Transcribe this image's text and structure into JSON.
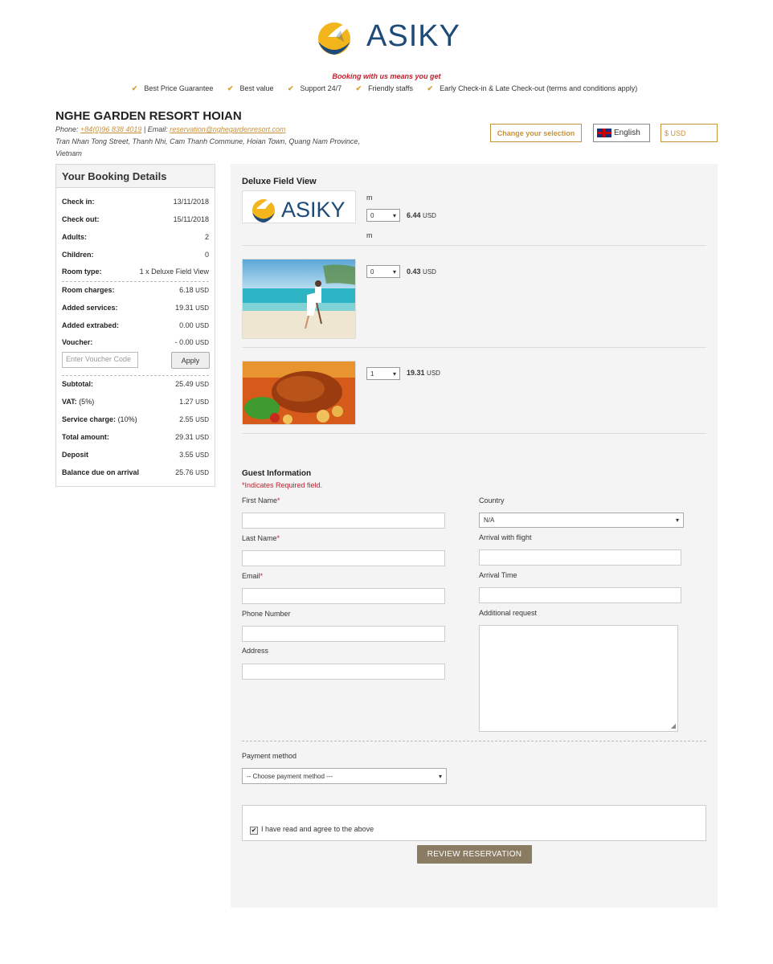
{
  "header": {
    "logo_text": "ASIKY",
    "tagline": "Booking with us means you get",
    "benefits": [
      "Best Price Guarantee",
      "Best value",
      "Support 24/7",
      "Friendly staffs",
      "Early Check-in & Late Check-out (terms and conditions apply)"
    ]
  },
  "hotel": {
    "name": "NGHE GARDEN RESORT HOIAN",
    "phone_label": "Phone:",
    "phone": "+84(0)96 838 4019",
    "email_label": "| Email:",
    "email": "reservation@nghegardenresort.com",
    "address": "Tran Nhan Tong Street, Thanh Nhi, Cam Thanh Commune, Hoian Town, Quang Nam Province, Vietnam"
  },
  "toolbar": {
    "change_label": "Change your selection",
    "language": "English",
    "currency": "$ USD"
  },
  "booking": {
    "title": "Your Booking Details",
    "check_in_label": "Check in:",
    "check_in": "13/11/2018",
    "check_out_label": "Check out:",
    "check_out": "15/11/2018",
    "adults_label": "Adults:",
    "adults": "2",
    "children_label": "Children:",
    "children": "0",
    "room_type_label": "Room type:",
    "room_type": "1 x Deluxe Field View",
    "room_charges_label": "Room charges:",
    "room_charges": "6.18",
    "added_services_label": "Added services:",
    "added_services": "19.31",
    "added_extrabed_label": "Added extrabed:",
    "added_extrabed": "0.00",
    "voucher_label": "Voucher:",
    "voucher": "- 0.00",
    "voucher_placeholder": "Enter Voucher Code",
    "apply_label": "Apply",
    "subtotal_label": "Subtotal:",
    "subtotal": "25.49",
    "vat_label": "VAT:",
    "vat_pct": "(5%)",
    "vat": "1.27",
    "service_label": "Service charge:",
    "service_pct": "(10%)",
    "service": "2.55",
    "total_label": "Total amount:",
    "total": "29.31",
    "deposit_label": "Deposit",
    "deposit": "3.55",
    "balance_label": "Balance due on arrival",
    "balance": "25.76",
    "unit": "USD"
  },
  "services": {
    "room_title": "Deluxe Field View",
    "m1": "m",
    "m2": "m",
    "items": [
      {
        "qty": "0",
        "price": "6.44",
        "unit": "USD"
      },
      {
        "qty": "0",
        "price": "0.43",
        "unit": "USD"
      },
      {
        "qty": "1",
        "price": "19.31",
        "unit": "USD"
      }
    ]
  },
  "guest": {
    "title": "Guest Information",
    "required_note": "*Indicates Required field.",
    "first_name": "First Name",
    "last_name": "Last Name",
    "email": "Email",
    "phone": "Phone Number",
    "address": "Address",
    "country_label": "Country",
    "country_value": "N/A",
    "flight_label": "Arrival with flight",
    "arrival_time_label": "Arrival Time",
    "request_label": "Additional request",
    "star": "*"
  },
  "payment": {
    "label": "Payment method",
    "placeholder": "-- Choose payment method ---"
  },
  "agree": {
    "text": "I have read and agree to the above",
    "checked": true
  },
  "review_button": "REVIEW RESERVATION",
  "colors": {
    "accent": "#c8913b",
    "required": "#c0202d",
    "review_button": "#8a7b63",
    "logo_blue": "#1e4a78",
    "logo_yellow": "#f2b51b"
  }
}
